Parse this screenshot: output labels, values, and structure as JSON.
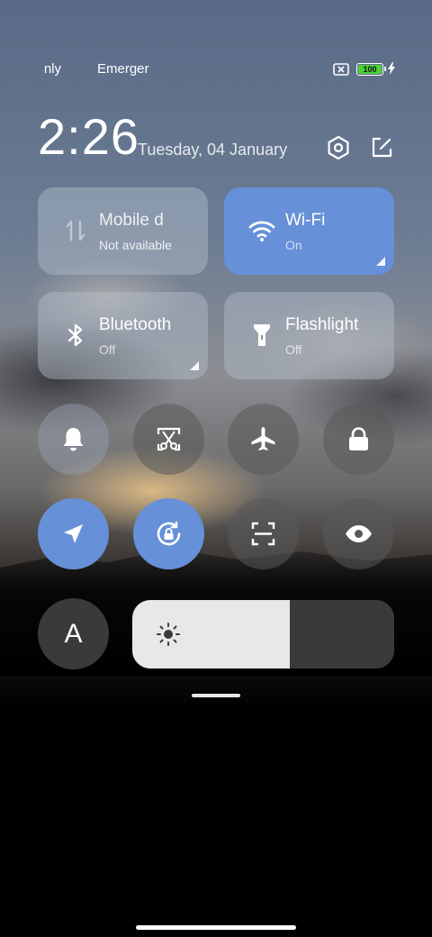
{
  "status_bar": {
    "carrier1": "nly",
    "carrier2": "Emerger",
    "battery_level": "100",
    "battery_color": "#4cd137"
  },
  "header": {
    "time": "2:26",
    "date": "Tuesday, 04 January",
    "settings_icon": "settings-hexagon-icon",
    "edit_icon": "edit-icon"
  },
  "tiles": [
    {
      "name": "Mobile d",
      "state": "Not available",
      "icon": "mobile-data-icon",
      "active": false
    },
    {
      "name": "Wi-Fi",
      "state": "On",
      "icon": "wifi-icon",
      "active": true
    },
    {
      "name": "Bluetooth",
      "state": "Off",
      "icon": "bluetooth-icon",
      "active": false
    },
    {
      "name": "Flashlight",
      "state": "Off",
      "icon": "flashlight-icon",
      "active": false
    }
  ],
  "toggles_row1": [
    {
      "icon": "bell-icon",
      "active": false
    },
    {
      "icon": "screenshot-scissors-icon",
      "active": false
    },
    {
      "icon": "airplane-icon",
      "active": false
    },
    {
      "icon": "lock-icon",
      "active": false
    }
  ],
  "toggles_row2": [
    {
      "icon": "location-icon",
      "active": true
    },
    {
      "icon": "rotation-lock-icon",
      "active": true
    },
    {
      "icon": "scanner-icon",
      "active": false
    },
    {
      "icon": "eye-icon",
      "active": false
    }
  ],
  "font_button": {
    "label": "A"
  },
  "brightness": {
    "level_fraction": 0.6,
    "icon": "sun-icon"
  },
  "colors": {
    "accent": "#6690d8"
  }
}
